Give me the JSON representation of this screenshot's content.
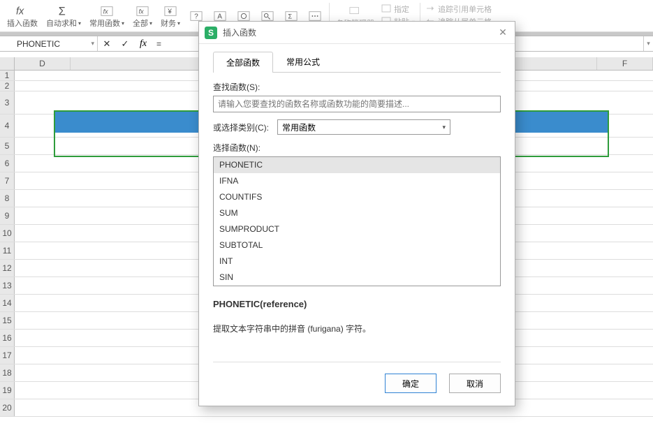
{
  "toolbar": {
    "insert_fn": "插入函数",
    "auto_sum": "自动求和",
    "common_fn": "常用函数",
    "all_fn": "全部",
    "finance": "财务",
    "name_mgr": "名称管理器",
    "paste": "粘贴",
    "specify": "指定",
    "trace_precedents": "追踪引用单元格",
    "trace_dependents": "追踪从属单元格"
  },
  "formula_bar": {
    "name_box": "PHONETIC",
    "formula": "="
  },
  "columns": [
    "D",
    "F"
  ],
  "rows": [
    "1",
    "2",
    "3",
    "4",
    "5",
    "6",
    "7",
    "8",
    "9",
    "10",
    "11",
    "12",
    "13",
    "14",
    "15",
    "16",
    "17",
    "18",
    "19",
    "20"
  ],
  "dialog": {
    "title": "插入函数",
    "tabs": {
      "all": "全部函数",
      "common": "常用公式"
    },
    "search_label": "查找函数(S):",
    "search_placeholder": "请输入您要查找的函数名称或函数功能的简要描述...",
    "category_label": "或选择类别(C):",
    "category_value": "常用函数",
    "select_label": "选择函数(N):",
    "functions": [
      "PHONETIC",
      "IFNA",
      "COUNTIFS",
      "SUM",
      "SUMPRODUCT",
      "SUBTOTAL",
      "INT",
      "SIN"
    ],
    "signature": "PHONETIC(reference)",
    "description": "提取文本字符串中的拼音 (furigana) 字符。",
    "ok": "确定",
    "cancel": "取消"
  }
}
